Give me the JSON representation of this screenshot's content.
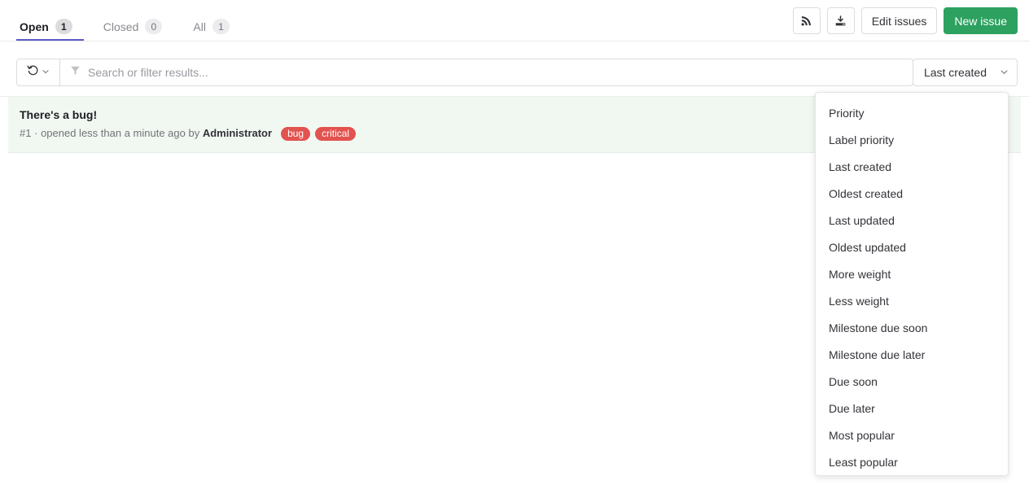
{
  "tabs": [
    {
      "label": "Open",
      "count": "1",
      "active": true
    },
    {
      "label": "Closed",
      "count": "0",
      "active": false
    },
    {
      "label": "All",
      "count": "1",
      "active": false
    }
  ],
  "actions": {
    "rss_icon": "rss-feed-icon",
    "export_icon": "download-export-icon",
    "edit_issues_label": "Edit issues",
    "new_issue_label": "New issue",
    "new_issue_color": "#2da160"
  },
  "filter_bar": {
    "recent_searches_icon": "history-rotate-icon",
    "recent_chevron_icon": "chevron-down-icon",
    "filter_icon": "filter-funnel-icon",
    "search_placeholder": "Search or filter results...",
    "search_value": "",
    "sort_label": "Last created",
    "sort_chevron_icon": "chevron-down-icon"
  },
  "issues": [
    {
      "title": "There's a bug!",
      "reference": "#1",
      "separator": "·",
      "opened_text": "opened less than a minute ago by",
      "author": "Administrator",
      "labels": [
        {
          "name": "bug",
          "color": "#e2524f"
        },
        {
          "name": "critical",
          "color": "#e2524f"
        }
      ]
    }
  ],
  "sort_menu": {
    "open": true,
    "items": [
      "Priority",
      "Label priority",
      "Last created",
      "Oldest created",
      "Last updated",
      "Oldest updated",
      "More weight",
      "Less weight",
      "Milestone due soon",
      "Milestone due later",
      "Due soon",
      "Due later",
      "Most popular",
      "Least popular"
    ]
  },
  "theme": {
    "active_tab_underline": "#5d5ac4",
    "issue_row_background": "#f1f8f2"
  }
}
